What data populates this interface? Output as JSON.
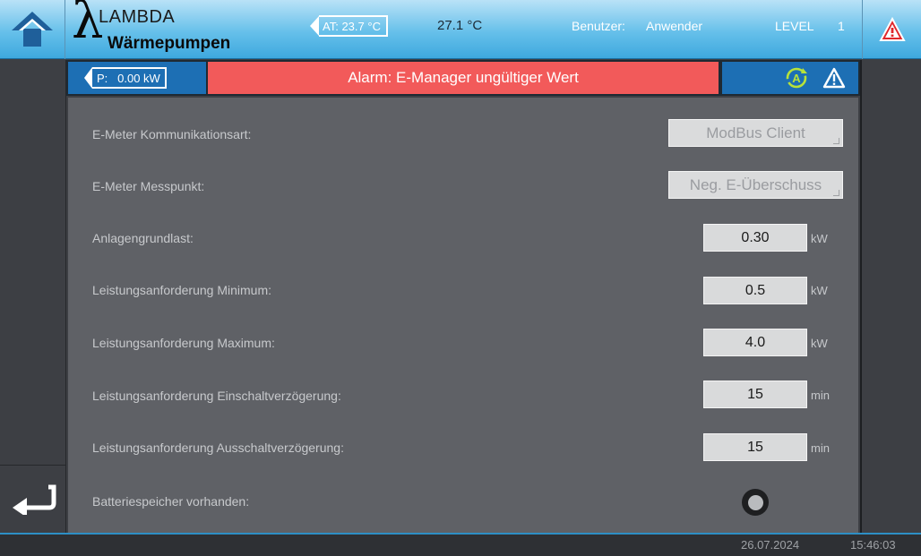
{
  "header": {
    "logo_top": "LAMBDA",
    "logo_bottom": "Wärmepumpen",
    "outside_temp_label": "AT:",
    "outside_temp_value": "23.7 °C",
    "temperature": "27.1 °C",
    "user_label": "Benutzer:",
    "user_value": "Anwender",
    "level_label": "LEVEL",
    "level_value": "1"
  },
  "status": {
    "power_label": "P:",
    "power_value": "0.00 kW",
    "alarm_message": "Alarm:  E-Manager ungültiger Wert",
    "auto_icon": "A"
  },
  "settings": {
    "comm_label": "E-Meter Kommunikationsart:",
    "comm_value": "ModBus Client",
    "measure_label": "E-Meter Messpunkt:",
    "measure_value": "Neg. E-Überschuss",
    "baseload_label": "Anlagengrundlast:",
    "baseload_value": "0.30",
    "baseload_unit": "kW",
    "min_label": "Leistungsanforderung Minimum:",
    "min_value": "0.5",
    "min_unit": "kW",
    "max_label": "Leistungsanforderung Maximum:",
    "max_value": "4.0",
    "max_unit": "kW",
    "on_delay_label": "Leistungsanforderung Einschaltverzögerung:",
    "on_delay_value": "15",
    "on_delay_unit": "min",
    "off_delay_label": "Leistungsanforderung Ausschaltverzögerung:",
    "off_delay_value": "15",
    "off_delay_unit": "min",
    "battery_label": "Batteriespeicher vorhanden:"
  },
  "footer": {
    "date": "26.07.2024",
    "time": "15:46:03"
  },
  "colors": {
    "header_blue": "#3ea8de",
    "alarm_red": "#f25a5a",
    "status_blue": "#1d6fb4",
    "content_gray": "#5f6166"
  },
  "icons": {
    "home": "home-icon",
    "warning": "warning-triangle-icon",
    "auto": "auto-mode-icon",
    "back": "back-arrow-icon"
  }
}
